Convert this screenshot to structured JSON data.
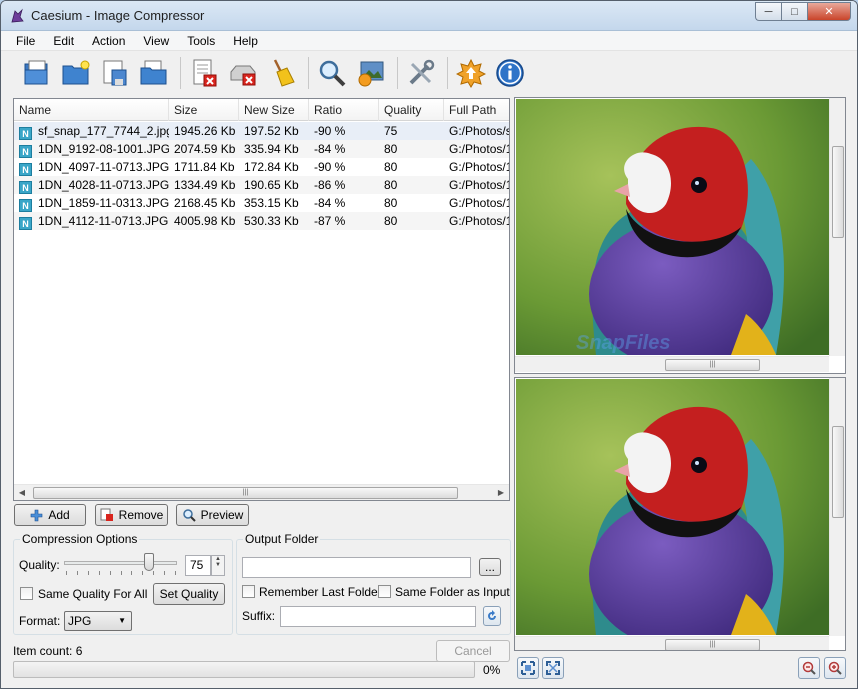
{
  "window": {
    "title": "Caesium - Image Compressor",
    "minimize": "─",
    "maximize": "□",
    "close": "✕"
  },
  "menu": [
    "File",
    "Edit",
    "Action",
    "View",
    "Tools",
    "Help"
  ],
  "toolbar": {
    "icons": [
      "open-files-icon",
      "open-folder-icon",
      "save-list-icon",
      "open-list-icon",
      "remove-item-icon",
      "clear-list-icon",
      "clean-icon",
      "preview-icon",
      "compress-icon",
      "settings-icon",
      "update-icon",
      "about-icon"
    ]
  },
  "table": {
    "columns": [
      "Name",
      "Size",
      "New Size",
      "Ratio",
      "Quality",
      "Full Path"
    ],
    "rows": [
      {
        "name": "sf_snap_177_7744_2.jpg",
        "size": "1945.26 Kb",
        "new_size": "197.52 Kb",
        "ratio": "-90 %",
        "quality": "75",
        "path": "G:/Photos/s"
      },
      {
        "name": "1DN_9192-08-1001.JPG",
        "size": "2074.59 Kb",
        "new_size": "335.94 Kb",
        "ratio": "-84 %",
        "quality": "80",
        "path": "G:/Photos/1"
      },
      {
        "name": "1DN_4097-11-0713.JPG",
        "size": "1711.84 Kb",
        "new_size": "172.84 Kb",
        "ratio": "-90 %",
        "quality": "80",
        "path": "G:/Photos/1"
      },
      {
        "name": "1DN_4028-11-0713.JPG",
        "size": "1334.49 Kb",
        "new_size": "190.65 Kb",
        "ratio": "-86 %",
        "quality": "80",
        "path": "G:/Photos/1"
      },
      {
        "name": "1DN_1859-11-0313.JPG",
        "size": "2168.45 Kb",
        "new_size": "353.15 Kb",
        "ratio": "-84 %",
        "quality": "80",
        "path": "G:/Photos/1"
      },
      {
        "name": "1DN_4112-11-0713.JPG",
        "size": "4005.98 Kb",
        "new_size": "530.33 Kb",
        "ratio": "-87 %",
        "quality": "80",
        "path": "G:/Photos/1"
      }
    ],
    "file_badge": "N"
  },
  "actions": {
    "add": "Add",
    "remove": "Remove",
    "preview": "Preview"
  },
  "compression": {
    "title": "Compression Options",
    "quality_label": "Quality:",
    "quality_value": "75",
    "quality_level": 0.75,
    "same_quality_label": "Same Quality For All",
    "set_quality_label": "Set Quality",
    "format_label": "Format:",
    "format_value": "JPG"
  },
  "output": {
    "title": "Output Folder",
    "folder_value": "",
    "browse_label": "...",
    "remember_label": "Remember Last Folder",
    "same_folder_label": "Same Folder as Input",
    "suffix_label": "Suffix:",
    "suffix_value": ""
  },
  "status": {
    "item_count": "Item count: 6",
    "cancel_label": "Cancel",
    "progress_text": "0%",
    "progress": 0
  },
  "preview": {
    "watermark": "SnapFiles"
  },
  "colors": {
    "accent": "#3399ff",
    "bird_red": "#c41f1f",
    "bird_purple": "#5b3f9c",
    "background_green": "#7aa23b"
  }
}
